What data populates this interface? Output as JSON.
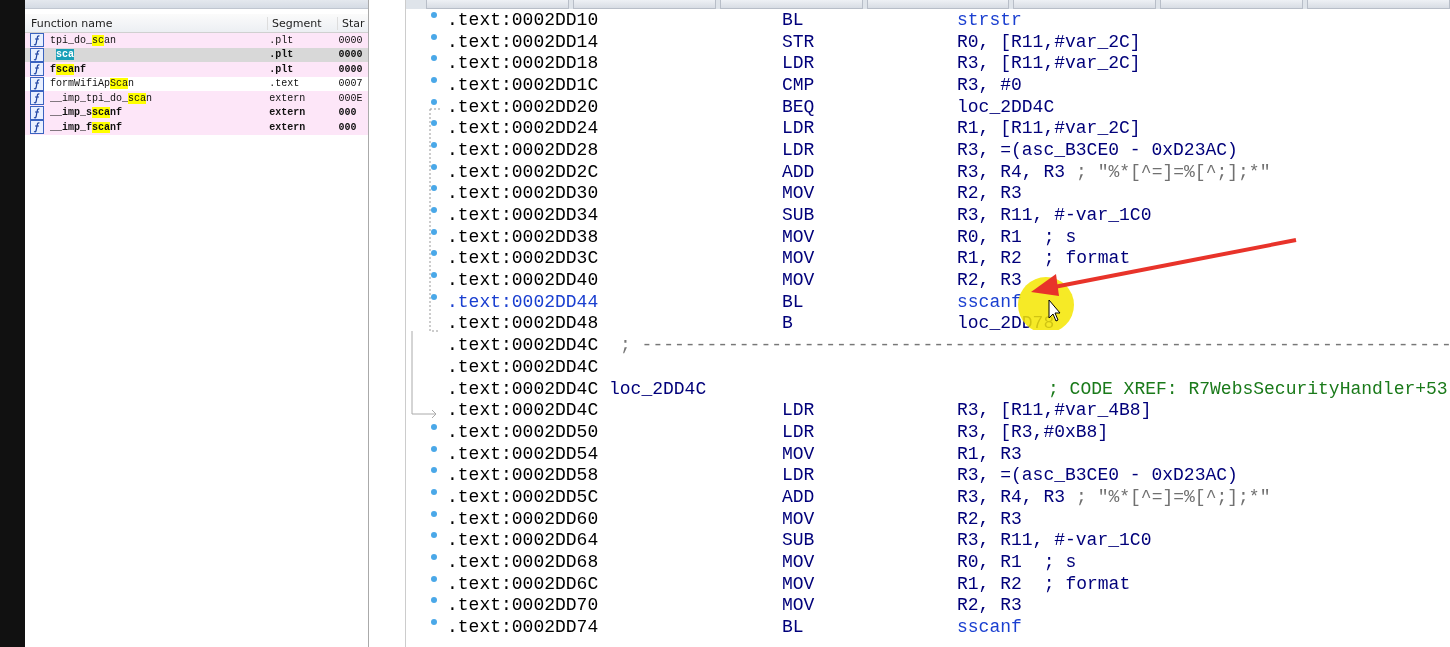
{
  "functions_window": {
    "columns": [
      "Function name",
      "Segment",
      "Star"
    ],
    "rows": [
      {
        "name_parts": [
          {
            "text": "tpi_do_",
            "highlight": false
          },
          {
            "text": "sc",
            "highlight": true
          },
          {
            "text": "an",
            "highlight": false
          }
        ],
        "segment": ".plt",
        "start": "0000",
        "library": true,
        "bold": false,
        "selected": false
      },
      {
        "name_parts": [
          {
            "text": "sca",
            "highlight": true
          }
        ],
        "segment": ".plt",
        "start": "0000",
        "library": true,
        "bold": true,
        "selected": true
      },
      {
        "name_parts": [
          {
            "text": "f",
            "highlight": false
          },
          {
            "text": "sca",
            "highlight": true
          },
          {
            "text": "nf",
            "highlight": false
          }
        ],
        "segment": ".plt",
        "start": "0000",
        "library": true,
        "bold": true,
        "selected": false
      },
      {
        "name_parts": [
          {
            "text": "formWifiAp",
            "highlight": false
          },
          {
            "text": "Sca",
            "highlight": true
          },
          {
            "text": "n",
            "highlight": false
          }
        ],
        "segment": ".text",
        "start": "0007",
        "library": false,
        "bold": false,
        "selected": false
      },
      {
        "name_parts": [
          {
            "text": "__imp_tpi_do_",
            "highlight": false
          },
          {
            "text": "sca",
            "highlight": true
          },
          {
            "text": "n",
            "highlight": false
          }
        ],
        "segment": "extern",
        "start": "000E",
        "library": true,
        "bold": false,
        "selected": false
      },
      {
        "name_parts": [
          {
            "text": "__imp_s",
            "highlight": false
          },
          {
            "text": "sca",
            "highlight": true
          },
          {
            "text": "nf",
            "highlight": false
          }
        ],
        "segment": "extern",
        "start": "000",
        "library": true,
        "bold": true,
        "selected": false
      },
      {
        "name_parts": [
          {
            "text": "__imp_f",
            "highlight": false
          },
          {
            "text": "sca",
            "highlight": true
          },
          {
            "text": "nf",
            "highlight": false
          }
        ],
        "segment": "extern",
        "start": "000",
        "library": true,
        "bold": true,
        "selected": false
      }
    ]
  },
  "disassembly": {
    "lines": [
      {
        "kind": "instr",
        "address": ".text:0002DD10",
        "mnemonic": "BL",
        "operands": "strstr",
        "name_ref": true,
        "dot": true,
        "current": false
      },
      {
        "kind": "instr",
        "address": ".text:0002DD14",
        "mnemonic": "STR",
        "operands": "R0, [R11,#var_2C]",
        "name_ref": false,
        "dot": true,
        "current": false
      },
      {
        "kind": "instr",
        "address": ".text:0002DD18",
        "mnemonic": "LDR",
        "operands": "R3, [R11,#var_2C]",
        "name_ref": false,
        "dot": true,
        "current": false
      },
      {
        "kind": "instr",
        "address": ".text:0002DD1C",
        "mnemonic": "CMP",
        "operands": "R3, #0",
        "name_ref": false,
        "dot": true,
        "current": false
      },
      {
        "kind": "instr",
        "address": ".text:0002DD20",
        "mnemonic": "BEQ",
        "operands": "loc_2DD4C",
        "name_ref": false,
        "dot": true,
        "current": false
      },
      {
        "kind": "instr",
        "address": ".text:0002DD24",
        "mnemonic": "LDR",
        "operands": "R1, [R11,#var_2C]",
        "name_ref": false,
        "dot": true,
        "current": false
      },
      {
        "kind": "instr",
        "address": ".text:0002DD28",
        "mnemonic": "LDR",
        "operands": "R3, =(asc_B3CE0 - 0xD23AC)",
        "name_ref": false,
        "dot": true,
        "current": false
      },
      {
        "kind": "instr",
        "address": ".text:0002DD2C",
        "mnemonic": "ADD",
        "operands": "R3, R4, R3",
        "comment": {
          "kind": "string",
          "text": "; \"%*[^=]=%[^;];*\""
        },
        "name_ref": false,
        "dot": true,
        "current": false
      },
      {
        "kind": "instr",
        "address": ".text:0002DD30",
        "mnemonic": "MOV",
        "operands": "R2, R3",
        "name_ref": false,
        "dot": true,
        "current": false
      },
      {
        "kind": "instr",
        "address": ".text:0002DD34",
        "mnemonic": "SUB",
        "operands": "R3, R11, #-var_1C0",
        "name_ref": false,
        "dot": true,
        "current": false
      },
      {
        "kind": "instr",
        "address": ".text:0002DD38",
        "mnemonic": "MOV",
        "operands": "R0, R1",
        "comment": {
          "kind": "plain",
          "text": "; s"
        },
        "name_ref": false,
        "dot": true,
        "current": false
      },
      {
        "kind": "instr",
        "address": ".text:0002DD3C",
        "mnemonic": "MOV",
        "operands": "R1, R2",
        "comment": {
          "kind": "plain",
          "text": "; format"
        },
        "name_ref": false,
        "dot": true,
        "current": false
      },
      {
        "kind": "instr",
        "address": ".text:0002DD40",
        "mnemonic": "MOV",
        "operands": "R2, R3",
        "name_ref": false,
        "dot": true,
        "current": false
      },
      {
        "kind": "instr",
        "address": ".text:0002DD44",
        "mnemonic": "BL",
        "operands": "sscanf",
        "name_ref": true,
        "dot": true,
        "current": true
      },
      {
        "kind": "instr",
        "address": ".text:0002DD48",
        "mnemonic": "B",
        "operands": "loc_2DD78",
        "name_ref": false,
        "dot": false,
        "current": false
      },
      {
        "kind": "separator",
        "address": ".text:0002DD4C",
        "comment": {
          "kind": "separator",
          "text": "; ---------------------------------------------------------------------------"
        }
      },
      {
        "kind": "blank",
        "address": ".text:0002DD4C"
      },
      {
        "kind": "label",
        "address": ".text:0002DD4C",
        "label": "loc_2DD4C",
        "comment": {
          "kind": "xref",
          "text": "; CODE XREF: R7WebsSecurityHandler+53"
        }
      },
      {
        "kind": "instr",
        "address": ".text:0002DD4C",
        "mnemonic": "LDR",
        "operands": "R3, [R11,#var_4B8]",
        "name_ref": false,
        "dot": false,
        "current": false
      },
      {
        "kind": "instr",
        "address": ".text:0002DD50",
        "mnemonic": "LDR",
        "operands": "R3, [R3,#0xB8]",
        "name_ref": false,
        "dot": true,
        "current": false
      },
      {
        "kind": "instr",
        "address": ".text:0002DD54",
        "mnemonic": "MOV",
        "operands": "R1, R3",
        "name_ref": false,
        "dot": true,
        "current": false
      },
      {
        "kind": "instr",
        "address": ".text:0002DD58",
        "mnemonic": "LDR",
        "operands": "R3, =(asc_B3CE0 - 0xD23AC)",
        "name_ref": false,
        "dot": true,
        "current": false
      },
      {
        "kind": "instr",
        "address": ".text:0002DD5C",
        "mnemonic": "ADD",
        "operands": "R3, R4, R3",
        "comment": {
          "kind": "string",
          "text": "; \"%*[^=]=%[^;];*\""
        },
        "name_ref": false,
        "dot": true,
        "current": false
      },
      {
        "kind": "instr",
        "address": ".text:0002DD60",
        "mnemonic": "MOV",
        "operands": "R2, R3",
        "name_ref": false,
        "dot": true,
        "current": false
      },
      {
        "kind": "instr",
        "address": ".text:0002DD64",
        "mnemonic": "SUB",
        "operands": "R3, R11, #-var_1C0",
        "name_ref": false,
        "dot": true,
        "current": false
      },
      {
        "kind": "instr",
        "address": ".text:0002DD68",
        "mnemonic": "MOV",
        "operands": "R0, R1",
        "comment": {
          "kind": "plain",
          "text": "; s"
        },
        "name_ref": false,
        "dot": true,
        "current": false
      },
      {
        "kind": "instr",
        "address": ".text:0002DD6C",
        "mnemonic": "MOV",
        "operands": "R1, R2",
        "comment": {
          "kind": "plain",
          "text": "; format"
        },
        "name_ref": false,
        "dot": true,
        "current": false
      },
      {
        "kind": "instr",
        "address": ".text:0002DD70",
        "mnemonic": "MOV",
        "operands": "R2, R3",
        "name_ref": false,
        "dot": true,
        "current": false
      },
      {
        "kind": "instr",
        "address": ".text:0002DD74",
        "mnemonic": "BL",
        "operands": "sscanf",
        "name_ref": true,
        "dot": true,
        "current": false
      }
    ]
  }
}
